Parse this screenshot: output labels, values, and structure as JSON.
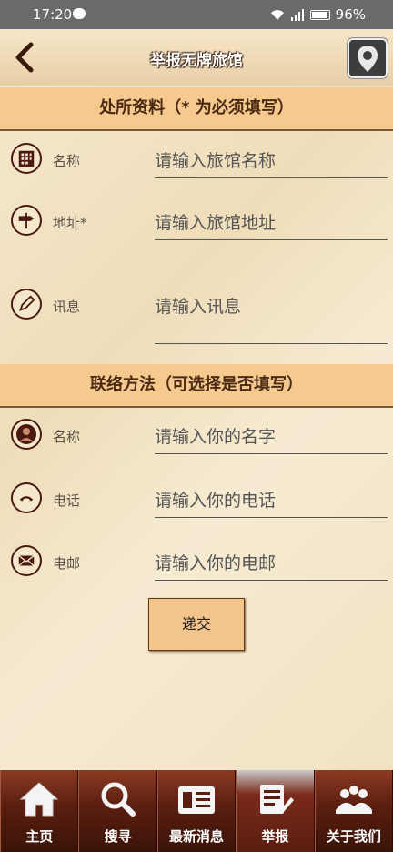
{
  "status": {
    "time": "17:20",
    "battery": "96%"
  },
  "header": {
    "title": "举报无牌旅馆"
  },
  "section1": {
    "title": "处所资料（* 为必须填写）"
  },
  "venue_fields": [
    {
      "label": "名称",
      "placeholder": "请输入旅馆名称"
    },
    {
      "label": "地址*",
      "placeholder": "请输入旅馆地址"
    },
    {
      "label": "讯息",
      "placeholder": "请输入讯息"
    }
  ],
  "section2": {
    "title": "联络方法（可选择是否填写）"
  },
  "contact_fields": [
    {
      "label": "名称",
      "placeholder": "请输入你的名字"
    },
    {
      "label": "电话",
      "placeholder": "请输入你的电话"
    },
    {
      "label": "电邮",
      "placeholder": "请输入你的电邮"
    }
  ],
  "submit_label": "递交",
  "tabs": [
    {
      "label": "主页"
    },
    {
      "label": "搜寻"
    },
    {
      "label": "最新消息"
    },
    {
      "label": "举报"
    },
    {
      "label": "关于我们"
    }
  ]
}
